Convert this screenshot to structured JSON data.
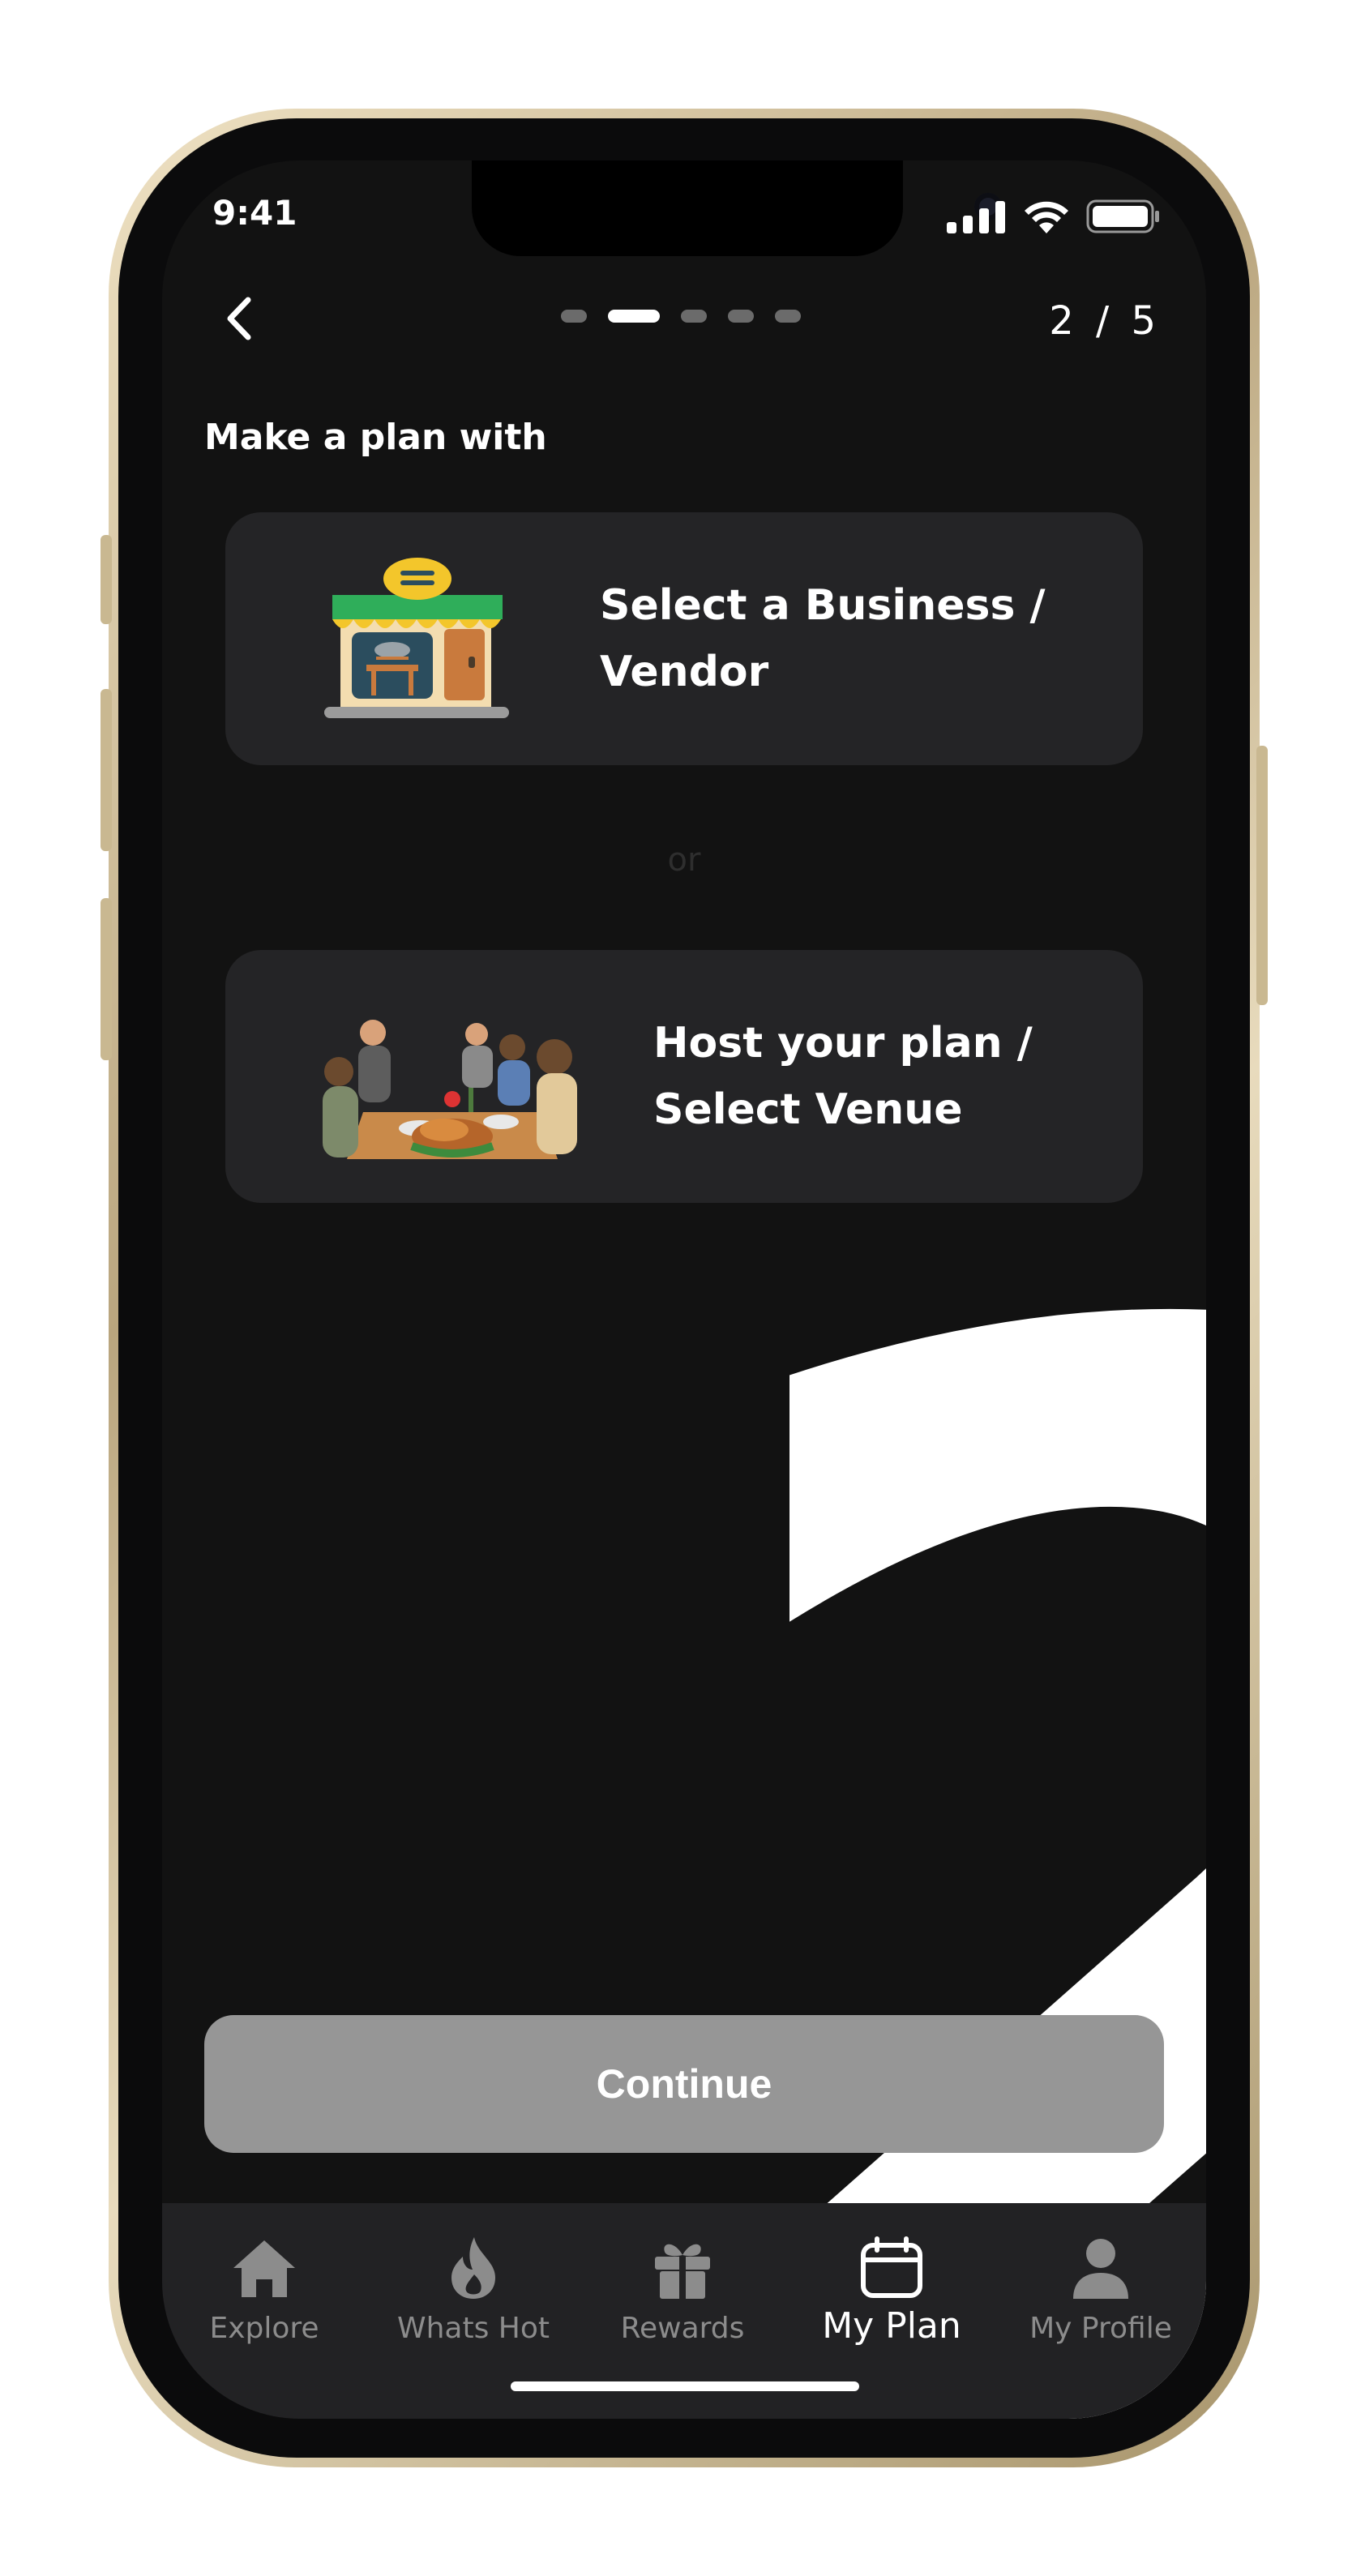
{
  "status_bar": {
    "time": "9:41"
  },
  "header": {
    "pager": {
      "total": 5,
      "current": 2
    },
    "step_count": "2 / 5"
  },
  "section_label": "Make a plan with",
  "background_numeral": "2",
  "options": [
    {
      "title": "Select a Business / Vendor",
      "icon": "restaurant-storefront-illustration"
    },
    {
      "title": "Host your plan / Select Venue",
      "icon": "dinner-party-illustration"
    }
  ],
  "divider_text": "or",
  "continue_label": "Continue",
  "tabs": [
    {
      "label": "Explore",
      "icon": "home-icon",
      "active": false
    },
    {
      "label": "Whats Hot",
      "icon": "flame-icon",
      "active": false
    },
    {
      "label": "Rewards",
      "icon": "gift-icon",
      "active": false
    },
    {
      "label": "My Plan",
      "icon": "calendar-icon",
      "active": true
    },
    {
      "label": "My Profile",
      "icon": "person-icon",
      "active": false
    }
  ],
  "colors": {
    "screen_bg": "#121212",
    "card_bg": "#242426",
    "continue_bg": "#969696",
    "tab_bar_bg": "#222224",
    "tab_inactive": "#8c8c8c",
    "tab_active": "#ffffff"
  }
}
